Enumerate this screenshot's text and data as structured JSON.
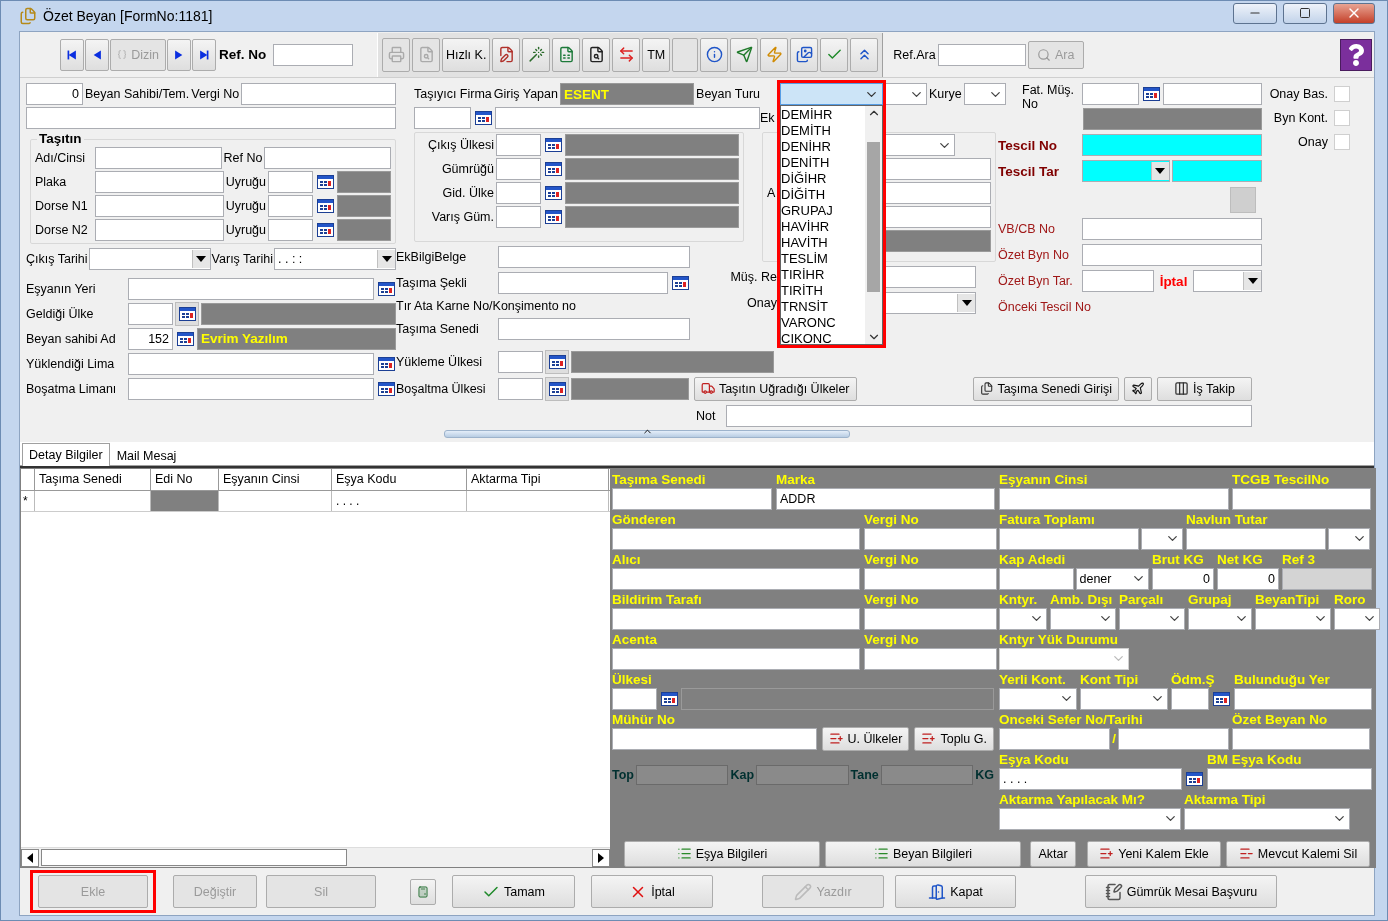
{
  "window": {
    "title": "Özet Beyan [FormNo:1181]"
  },
  "navigator": {
    "buttons": [
      {
        "disabled": false
      },
      {
        "disabled": false
      },
      {
        "label": "Dizin",
        "disabled": true
      },
      {
        "disabled": false
      },
      {
        "disabled": false
      }
    ],
    "ref_label": "Ref. No"
  },
  "tools": [
    {
      "disabled": true
    },
    {
      "disabled": true
    },
    {
      "label": "Hızlı K.",
      "disabled": false
    },
    {
      "disabled": false
    },
    {
      "disabled": false
    },
    {
      "disabled": false
    },
    {
      "disabled": false
    },
    {
      "disabled": false
    },
    {
      "label": "TM",
      "disabled": false
    },
    {
      "disabled": true
    },
    {
      "disabled": false
    },
    {
      "disabled": false
    },
    {
      "disabled": false
    },
    {
      "disabled": false
    },
    {
      "disabled": false
    },
    {
      "disabled": false
    }
  ],
  "search": {
    "label": "Ref.Ara",
    "button": "Ara",
    "disabled": true
  },
  "header": {
    "col_a": {
      "rows": [
        [
          {
            "kind": "short-field",
            "value": "0"
          },
          {
            "kind": "label",
            "text": "Beyan Sahibi/Tem."
          },
          {
            "kind": "label",
            "text": "Vergi No"
          },
          {
            "kind": "field"
          }
        ],
        [
          {
            "kind": "field"
          }
        ]
      ],
      "group": {
        "title": "Taşıtın",
        "rows": [
          [
            {
              "kind": "label",
              "text": "Adı/Cinsi"
            },
            {
              "kind": "field"
            },
            {
              "kind": "label",
              "text": "Ref No"
            },
            {
              "kind": "field"
            }
          ],
          [
            {
              "kind": "label",
              "text": "Plaka"
            },
            {
              "kind": "field"
            },
            {
              "kind": "label",
              "text": "Uyruğu"
            },
            {
              "kind": "code-field"
            },
            {
              "kind": "lookup"
            },
            {
              "kind": "short-bar"
            }
          ],
          [
            {
              "kind": "label",
              "text": "Dorse N1"
            },
            {
              "kind": "field"
            },
            {
              "kind": "label",
              "text": "Uyruğu"
            },
            {
              "kind": "code-field"
            },
            {
              "kind": "lookup"
            },
            {
              "kind": "short-bar"
            }
          ],
          [
            {
              "kind": "label",
              "text": "Dorse N2"
            },
            {
              "kind": "field"
            },
            {
              "kind": "label",
              "text": "Uyruğu"
            },
            {
              "kind": "code-field"
            },
            {
              "kind": "lookup"
            },
            {
              "kind": "short-bar"
            }
          ]
        ]
      },
      "dates": [
        {
          "kind": "label",
          "text": "Çıkış Tarihi"
        },
        {
          "kind": "drop-combo"
        },
        {
          "kind": "label",
          "text": "Varış Tarihi"
        },
        {
          "kind": "drop-combo",
          "value": ". .      : :"
        }
      ],
      "lower_rows": [
        [
          {
            "kind": "label",
            "text": "Eşyanın Yeri"
          },
          {
            "kind": "field"
          },
          {
            "kind": "lookup"
          }
        ],
        [
          {
            "kind": "label",
            "text": "Geldiği Ülke"
          },
          {
            "kind": "code-field"
          },
          {
            "kind": "lookup-button"
          },
          {
            "kind": "info-bar"
          }
        ],
        [
          {
            "kind": "label",
            "text": "Beyan sahibi Ad"
          },
          {
            "kind": "code-field",
            "value": "152"
          },
          {
            "kind": "lookup"
          },
          {
            "kind": "info-bar",
            "value": "Evrim Yazılım"
          }
        ],
        [
          {
            "kind": "label",
            "text": "Yüklendiği Lima"
          },
          {
            "kind": "field"
          },
          {
            "kind": "lookup"
          }
        ],
        [
          {
            "kind": "label",
            "text": "Boşatma Limanı"
          },
          {
            "kind": "field"
          },
          {
            "kind": "lookup"
          }
        ]
      ]
    },
    "col_b": {
      "rows": [
        [
          {
            "kind": "label",
            "text": "Taşıyıcı Firma"
          },
          {
            "kind": "label",
            "text": "Giriş Yapan"
          },
          {
            "kind": "info-bar",
            "value": "ESENT"
          },
          {
            "kind": "label",
            "text": "Beyan Turu"
          }
        ],
        [
          {
            "kind": "short-field"
          },
          {
            "kind": "lookup"
          },
          {
            "kind": "field"
          }
        ]
      ],
      "group_rows": [
        [
          {
            "kind": "label",
            "text": "Çıkış Ülkesi"
          },
          {
            "kind": "code-field"
          },
          {
            "kind": "lookup"
          },
          {
            "kind": "info-bar"
          }
        ],
        [
          {
            "kind": "label",
            "text": "Gümrüğü"
          },
          {
            "kind": "code-field"
          },
          {
            "kind": "lookup"
          },
          {
            "kind": "info-bar"
          }
        ],
        [
          {
            "kind": "label",
            "text": "Gid. Ülke"
          },
          {
            "kind": "code-field"
          },
          {
            "kind": "lookup"
          },
          {
            "kind": "info-bar"
          }
        ],
        [
          {
            "kind": "label",
            "text": "Varış Güm."
          },
          {
            "kind": "code-field"
          },
          {
            "kind": "lookup"
          },
          {
            "kind": "info-bar"
          }
        ]
      ],
      "lower_rows": [
        [
          {
            "kind": "label",
            "text": "EkBilgiBelge"
          },
          {
            "kind": "field"
          }
        ],
        [
          {
            "kind": "label",
            "text": "Taşıma Şekli"
          },
          {
            "kind": "field"
          },
          {
            "kind": "lookup"
          }
        ],
        [
          {
            "kind": "label",
            "text": "Tır Ata Karne No/Konşimento no"
          }
        ],
        [
          {
            "kind": "label",
            "text": "Taşıma Senedi"
          },
          {
            "kind": "field"
          }
        ]
      ]
    },
    "beyan_turu": {
      "open": true,
      "highlighted": true,
      "options": [
        "DEMİHR",
        "DEMİTH",
        "DENİHR",
        "DENİTH",
        "DİĞİHR",
        "DİĞİTH",
        "GRUPAJ",
        "HAVİHR",
        "HAVİTH",
        "TESLİM",
        "TIRİHR",
        "TIRİTH",
        "TRNSİT",
        "VARONC",
        "CIKONC"
      ]
    },
    "col_c": {
      "first_row": [
        {
          "kind": "small-combo"
        },
        {
          "kind": "label",
          "text": "Kurye"
        },
        {
          "kind": "small-combo"
        }
      ],
      "rows": [
        [
          {
            "kind": "label",
            "text": "Ek"
          }
        ]
      ],
      "group_rows": [
        [
          {
            "kind": "combo"
          }
        ],
        [
          {
            "kind": "field"
          }
        ],
        [
          {
            "kind": "label",
            "text": "A"
          },
          {
            "kind": "field"
          }
        ],
        [
          {
            "kind": "field"
          }
        ],
        [
          {
            "kind": "info-bar"
          }
        ]
      ],
      "lower_rows": [
        [
          {
            "kind": "label",
            "text": "Müş. Re"
          },
          {
            "kind": "field"
          }
        ],
        [
          {
            "kind": "label",
            "text": "Onay"
          },
          {
            "kind": "drop-combo"
          }
        ]
      ]
    },
    "col_d": {
      "rows": [
        [
          {
            "kind": "wrap-label",
            "text": "Fat. Müş. No"
          },
          {
            "kind": "short-field"
          },
          {
            "kind": "lookup"
          },
          {
            "kind": "field"
          }
        ],
        [
          {
            "kind": "info-bar"
          }
        ],
        [
          {
            "kind": "strong-label",
            "text": "Tescil No"
          },
          {
            "kind": "cyan-field"
          }
        ],
        [
          {
            "kind": "strong-label",
            "text": "Tescil Tar"
          },
          {
            "kind": "cyan-combo"
          },
          {
            "kind": "cyan-field"
          }
        ],
        [
          {
            "kind": "blank-button"
          }
        ],
        [
          {
            "kind": "red-label",
            "text": "VB/CB No"
          },
          {
            "kind": "field"
          }
        ],
        [
          {
            "kind": "red-label",
            "text": "Özet Byn No"
          },
          {
            "kind": "field"
          }
        ],
        [
          {
            "kind": "red-label",
            "text": "Özet Byn Tar."
          },
          {
            "kind": "field"
          },
          {
            "kind": "alert-label",
            "text": "İptal"
          },
          {
            "kind": "drop-combo"
          }
        ],
        [
          {
            "kind": "red-label",
            "text": "Önceki Tescil No"
          }
        ]
      ]
    },
    "approvals": [
      {
        "label": "Onay Bas.",
        "checked": false
      },
      {
        "label": "Byn Kont.",
        "checked": false
      },
      {
        "label": "Onay",
        "checked": false
      }
    ],
    "bottom_rows": [
      [
        {
          "kind": "label",
          "text": "Yükleme Ülkesi"
        },
        {
          "kind": "code-field"
        },
        {
          "kind": "lookup-button"
        },
        {
          "kind": "info-bar"
        }
      ],
      [
        {
          "kind": "label",
          "text": "Boşaltma Ülkesi"
        },
        {
          "kind": "code-field"
        },
        {
          "kind": "lookup-button"
        },
        {
          "kind": "info-bar"
        },
        {
          "kind": "button",
          "label": "Taşıtın Uğradığı Ülkeler"
        },
        {
          "kind": "spacer"
        },
        {
          "kind": "button",
          "label": "Taşıma Senedi Girişi"
        },
        {
          "kind": "icon-button"
        },
        {
          "kind": "button",
          "label": "İş Takip"
        }
      ],
      [
        {
          "kind": "label",
          "text": "Not"
        },
        {
          "kind": "field"
        }
      ]
    ]
  },
  "tabs": [
    {
      "label": "Detay Bilgiler",
      "selected": true
    },
    {
      "label": "Mail Mesaj",
      "selected": false
    }
  ],
  "grid": {
    "columns": [
      "Taşıma Senedi",
      "Edi No",
      "Eşyanın Cinsi",
      "Eşya Kodu",
      "Aktarma Tipi"
    ],
    "new_row": {
      "marker": "*",
      "cells": [
        {
          "kind": "text"
        },
        {
          "kind": "locked"
        },
        {
          "kind": "text"
        },
        {
          "kind": "text",
          "value": ". . . ."
        },
        {
          "kind": "text"
        }
      ]
    }
  },
  "detail": {
    "left_rows": [
      [
        {
          "label": "Taşıma Senedi",
          "items": [
            {
              "kind": "field"
            }
          ]
        },
        {
          "label": "Marka",
          "items": [
            {
              "kind": "field",
              "value": "ADDR"
            }
          ]
        }
      ],
      [
        {
          "label": "Gönderen",
          "items": [
            {
              "kind": "field"
            }
          ]
        },
        {
          "label": "Vergi No",
          "items": [
            {
              "kind": "field"
            }
          ]
        }
      ],
      [
        {
          "label": "Alıcı",
          "items": [
            {
              "kind": "field"
            }
          ]
        },
        {
          "label": "Vergi No",
          "items": [
            {
              "kind": "field"
            }
          ]
        }
      ],
      [
        {
          "label": "Bildirim Tarafı",
          "items": [
            {
              "kind": "field"
            }
          ]
        },
        {
          "label": "Vergi No",
          "items": [
            {
              "kind": "field"
            }
          ]
        }
      ],
      [
        {
          "label": "Acenta",
          "items": [
            {
              "kind": "field"
            }
          ]
        },
        {
          "label": "Vergi No",
          "items": [
            {
              "kind": "field"
            }
          ]
        }
      ],
      [
        {
          "label": "Ülkesi",
          "items": [
            {
              "kind": "code-field"
            },
            {
              "kind": "lookup"
            },
            {
              "kind": "info-bar"
            }
          ]
        }
      ],
      [
        {
          "label": "Mühür No",
          "items": [
            {
              "kind": "field"
            },
            {
              "kind": "button",
              "label": "U. Ülkeler"
            },
            {
              "kind": "button",
              "label": "Toplu G."
            }
          ]
        }
      ]
    ],
    "totals": [
      "Top",
      "Kap",
      "Tane",
      "KG"
    ],
    "right_rows": [
      [
        {
          "label": "Eşyanın Cinsi",
          "items": [
            {
              "kind": "field"
            }
          ]
        },
        {
          "label": "TCGB TescilNo",
          "items": [
            {
              "kind": "field"
            }
          ]
        }
      ],
      [
        {
          "label": "Fatura Toplamı",
          "items": [
            {
              "kind": "field"
            },
            {
              "kind": "small-combo"
            }
          ]
        },
        {
          "label": "Navlun Tutar",
          "items": [
            {
              "kind": "field"
            },
            {
              "kind": "small-combo"
            }
          ]
        }
      ],
      [
        {
          "label": "Kap Adedi",
          "items": [
            {
              "kind": "field"
            },
            {
              "kind": "combo",
              "value": "dener"
            }
          ]
        },
        {
          "label": "Brut KG",
          "items": [
            {
              "kind": "number-field",
              "value": "0"
            }
          ]
        },
        {
          "label": "Net KG",
          "items": [
            {
              "kind": "number-field",
              "value": "0"
            }
          ]
        },
        {
          "label": "Ref 3",
          "items": [
            {
              "kind": "locked-field"
            }
          ]
        }
      ],
      [
        {
          "label": "Kntyr.",
          "items": [
            {
              "kind": "combo"
            }
          ]
        },
        {
          "label": "Amb. Dışı",
          "items": [
            {
              "kind": "combo"
            }
          ]
        },
        {
          "label": "Parçalı",
          "items": [
            {
              "kind": "combo"
            }
          ]
        },
        {
          "label": "Grupaj",
          "items": [
            {
              "kind": "combo"
            }
          ]
        },
        {
          "label": "BeyanTipi",
          "items": [
            {
              "kind": "combo"
            }
          ]
        },
        {
          "label": "Roro",
          "items": [
            {
              "kind": "combo"
            }
          ]
        }
      ],
      [
        {
          "label": "Kntyr Yük Durumu",
          "items": [
            {
              "kind": "locked-combo"
            }
          ]
        }
      ],
      [
        {
          "label": "Yerli Kont.",
          "items": [
            {
              "kind": "combo"
            }
          ]
        },
        {
          "label": "Kont Tipi",
          "items": [
            {
              "kind": "combo"
            }
          ]
        },
        {
          "label": "Ödm.Ş",
          "items": [
            {
              "kind": "field"
            },
            {
              "kind": "lookup"
            }
          ]
        },
        {
          "label": "Bulunduğu Yer",
          "items": [
            {
              "kind": "field"
            }
          ]
        }
      ],
      [
        {
          "label": "Onceki Sefer No/Tarihi",
          "items": [
            {
              "kind": "field"
            },
            {
              "kind": "slash",
              "text": "/"
            },
            {
              "kind": "field"
            }
          ]
        },
        {
          "label": "Özet Beyan No",
          "items": [
            {
              "kind": "field"
            }
          ]
        }
      ],
      [
        {
          "label": "Eşya Kodu",
          "items": [
            {
              "kind": "field",
              "value": ". . . ."
            },
            {
              "kind": "lookup"
            }
          ]
        },
        {
          "label": "BM Eşya Kodu",
          "items": [
            {
              "kind": "field"
            }
          ]
        }
      ],
      [
        {
          "label": "Aktarma Yapılacak Mı?",
          "items": [
            {
              "kind": "combo"
            }
          ]
        },
        {
          "label": "Aktarma Tipi",
          "items": [
            {
              "kind": "combo"
            }
          ]
        }
      ]
    ],
    "buttons": [
      "Eşya Bilgileri",
      "Beyan Bilgileri",
      "Aktar",
      "Yeni Kalem Ekle",
      "Mevcut Kalemi Sil"
    ]
  },
  "footer": [
    {
      "label": "Ekle",
      "disabled": true,
      "highlighted": true
    },
    {
      "label": "Değiştir",
      "disabled": true,
      "highlighted": false
    },
    {
      "label": "Sil",
      "disabled": true,
      "highlighted": false
    },
    {
      "disabled": false,
      "highlighted": false
    },
    {
      "label": "Tamam",
      "disabled": false,
      "highlighted": false
    },
    {
      "label": "İptal",
      "disabled": false,
      "highlighted": false
    },
    {
      "label": "Yazdır",
      "disabled": true,
      "highlighted": false
    },
    {
      "label": "Kapat",
      "disabled": false,
      "highlighted": false
    },
    {
      "label": "Gümrük Mesai Başvuru",
      "disabled": false,
      "highlighted": false
    }
  ]
}
